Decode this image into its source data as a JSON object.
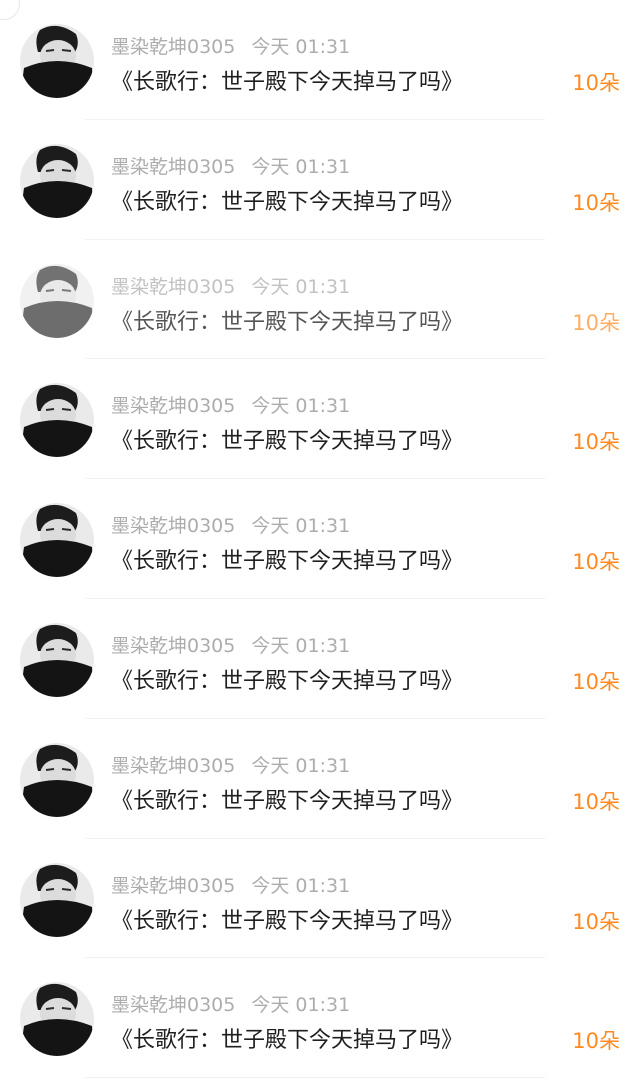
{
  "colors": {
    "accent": "#ff8a1f",
    "meta_text": "#adadad",
    "title_text": "#1f1f1f"
  },
  "gifts": [
    {
      "user": "墨染乾坤0305",
      "time": "今天 01:31",
      "title": "《长歌行：世子殿下今天掉马了吗》",
      "count": "10朵",
      "avatar_icon": "user-avatar-icon"
    },
    {
      "user": "墨染乾坤0305",
      "time": "今天 01:31",
      "title": "《长歌行：世子殿下今天掉马了吗》",
      "count": "10朵",
      "avatar_icon": "user-avatar-icon"
    },
    {
      "user": "墨染乾坤0305",
      "time": "今天 01:31",
      "title": "《长歌行：世子殿下今天掉马了吗》",
      "count": "10朵",
      "avatar_icon": "user-avatar-icon"
    },
    {
      "user": "墨染乾坤0305",
      "time": "今天 01:31",
      "title": "《长歌行：世子殿下今天掉马了吗》",
      "count": "10朵",
      "avatar_icon": "user-avatar-icon"
    },
    {
      "user": "墨染乾坤0305",
      "time": "今天 01:31",
      "title": "《长歌行：世子殿下今天掉马了吗》",
      "count": "10朵",
      "avatar_icon": "user-avatar-icon"
    },
    {
      "user": "墨染乾坤0305",
      "time": "今天 01:31",
      "title": "《长歌行：世子殿下今天掉马了吗》",
      "count": "10朵",
      "avatar_icon": "user-avatar-icon"
    },
    {
      "user": "墨染乾坤0305",
      "time": "今天 01:31",
      "title": "《长歌行：世子殿下今天掉马了吗》",
      "count": "10朵",
      "avatar_icon": "user-avatar-icon"
    },
    {
      "user": "墨染乾坤0305",
      "time": "今天 01:31",
      "title": "《长歌行：世子殿下今天掉马了吗》",
      "count": "10朵",
      "avatar_icon": "user-avatar-icon"
    },
    {
      "user": "墨染乾坤0305",
      "time": "今天 01:31",
      "title": "《长歌行：世子殿下今天掉马了吗》",
      "count": "10朵",
      "avatar_icon": "user-avatar-icon"
    }
  ]
}
